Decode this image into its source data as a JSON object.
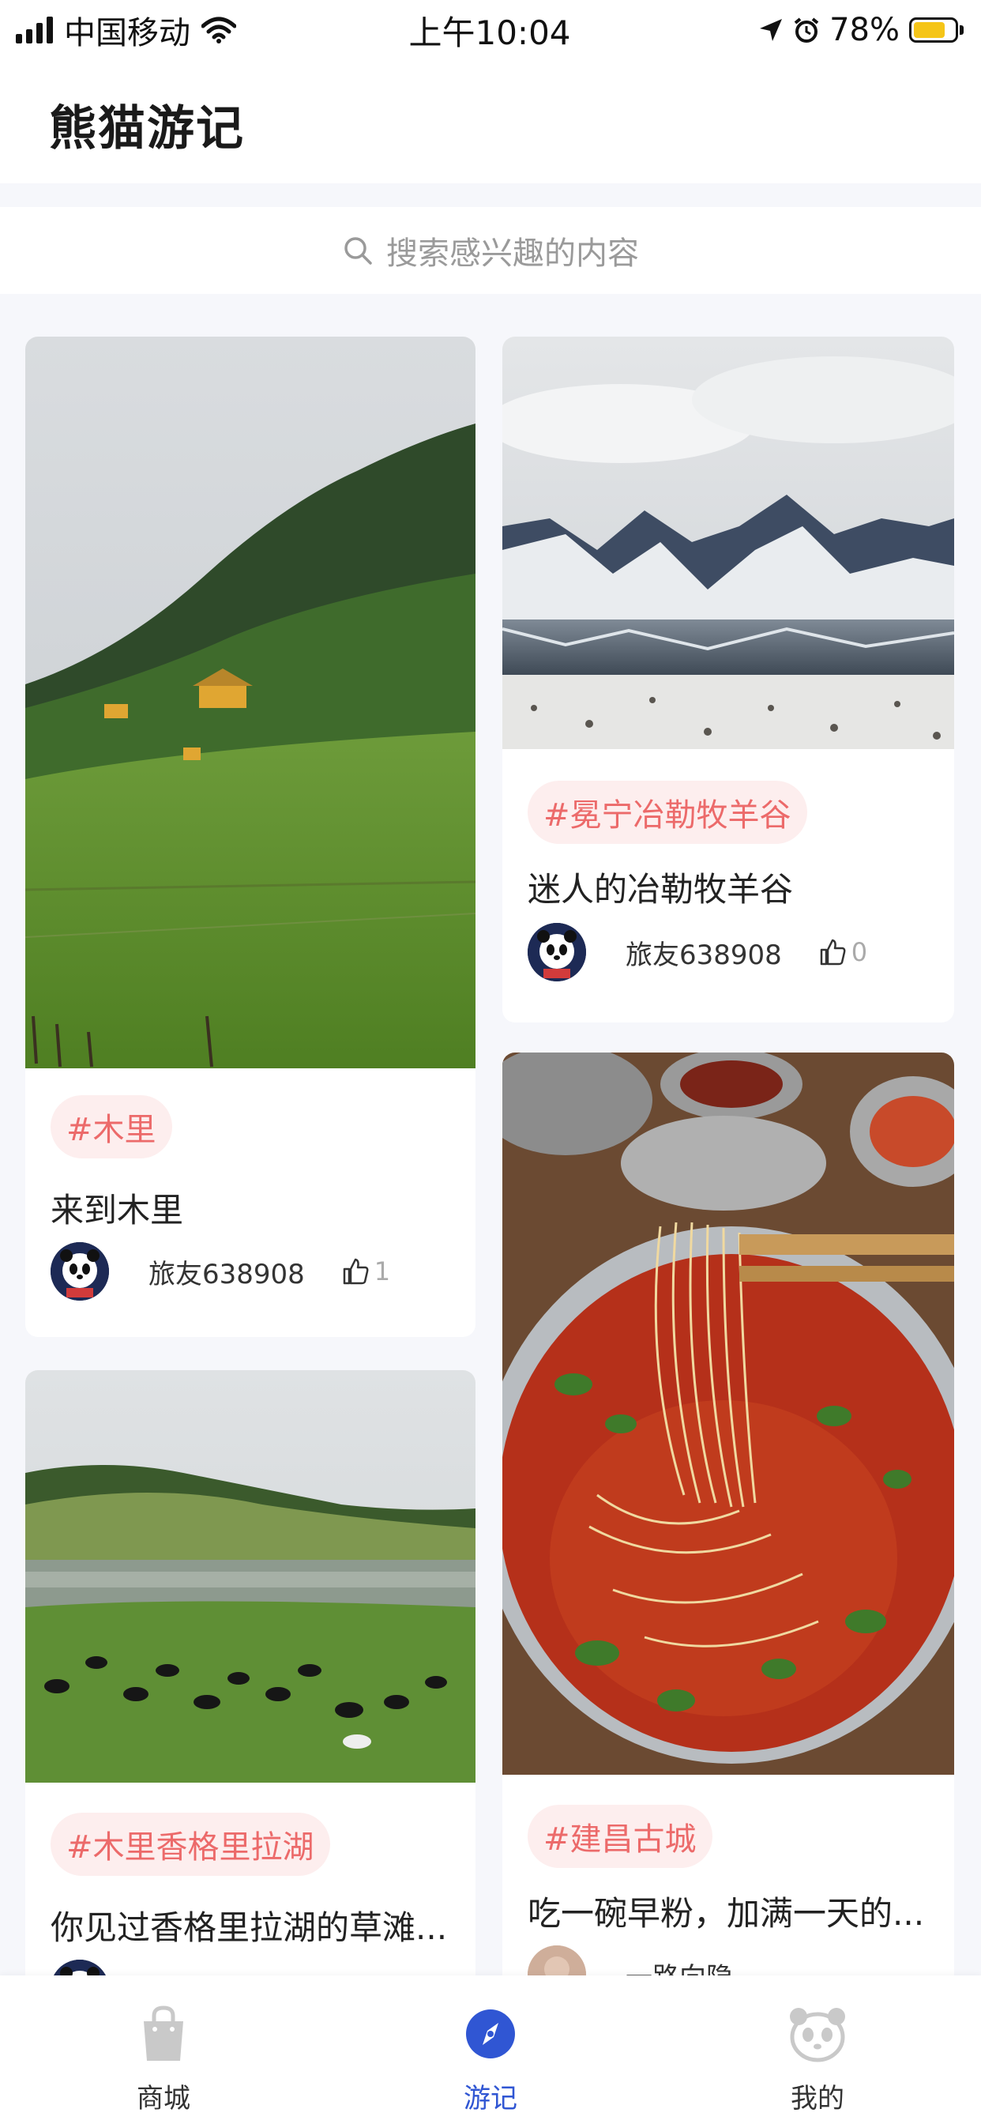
{
  "status_bar": {
    "carrier": "中国移动",
    "time": "上午10:04",
    "battery_percent": "78%",
    "battery_level": 0.78
  },
  "header": {
    "title": "熊猫游记"
  },
  "search": {
    "placeholder": "搜索感兴趣的内容"
  },
  "cards": [
    {
      "tag": "#木里",
      "title": "来到木里",
      "author": "旅友638908",
      "likes": "1",
      "image": "mountain-monastery-photo"
    },
    {
      "tag": "#木里香格里拉湖",
      "title": "你见过香格里拉湖的草滩...",
      "author": "",
      "likes": "",
      "image": "lake-yak-pasture-photo"
    },
    {
      "tag": "#冕宁冶勒牧羊谷",
      "title": "迷人的冶勒牧羊谷",
      "author": "旅友638908",
      "likes": "0",
      "image": "snowy-mountain-lake-photo"
    },
    {
      "tag": "#建昌古城",
      "title": "吃一碗早粉，加满一天的...",
      "author": "一路向隐",
      "likes": "",
      "image": "noodle-bowl-photo"
    }
  ],
  "tabs": [
    {
      "label": "商城",
      "icon": "shopping-bag-icon",
      "active": false
    },
    {
      "label": "游记",
      "icon": "compass-icon",
      "active": true
    },
    {
      "label": "我的",
      "icon": "panda-icon",
      "active": false
    }
  ],
  "colors": {
    "accent": "#3056d3",
    "tag_bg": "#fdeeee",
    "tag_text": "#ec6a6a",
    "page_bg": "#f6f7fb"
  }
}
